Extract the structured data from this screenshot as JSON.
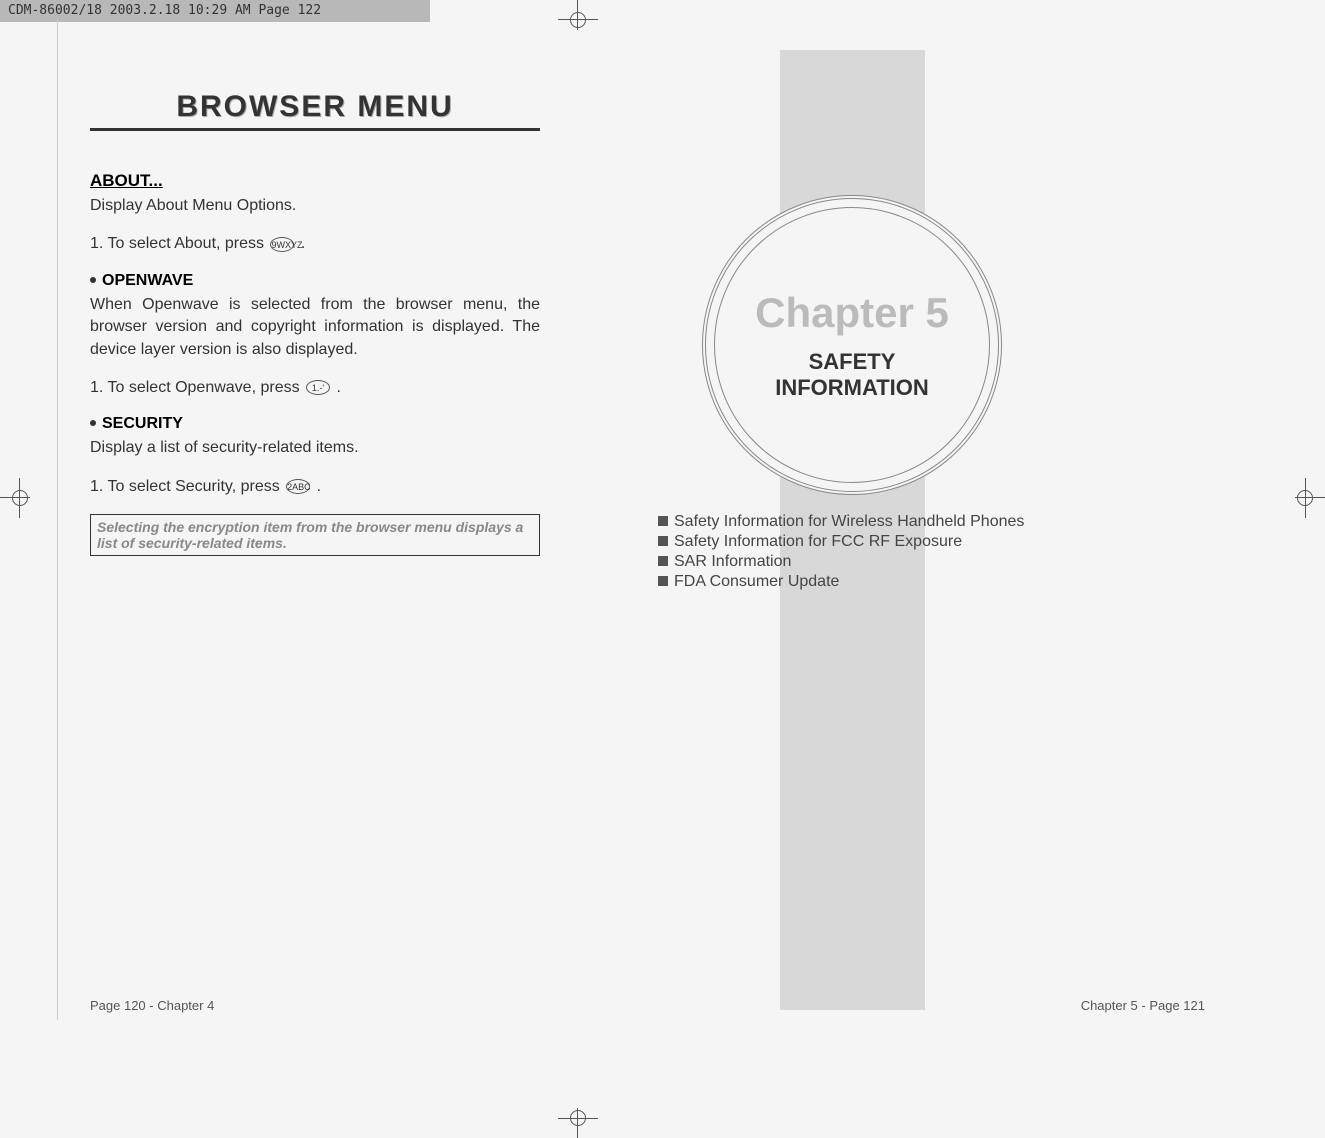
{
  "header_strip": "CDM-86002/18  2003.2.18  10:29 AM  Page 122",
  "left_page": {
    "title": "BROWSER MENU",
    "about_heading": "ABOUT...",
    "about_desc": "Display About Menu Options.",
    "about_step": "1. To select About, press ",
    "about_key": "9WXYZ",
    "openwave_heading": "OPENWAVE",
    "openwave_desc": "When Openwave is selected from the browser menu, the browser version and copyright information is displayed. The device layer version is also displayed.",
    "openwave_step": "1. To select Openwave, press ",
    "openwave_key": "1.-'",
    "security_heading": "SECURITY",
    "security_desc": "Display a list of security-related items.",
    "security_step": "1. To select Security, press ",
    "security_key": "2ABC",
    "callout": "Selecting the encryption item from the browser menu displays a list of security-related items.",
    "footer": "Page 120 - Chapter 4"
  },
  "right_page": {
    "chapter_title": "Chapter 5",
    "chapter_sub1": "SAFETY",
    "chapter_sub2": "INFORMATION",
    "toc_items": [
      "Safety Information for Wireless Handheld Phones",
      "Safety Information for FCC RF Exposure",
      "SAR Information",
      "FDA Consumer Update"
    ],
    "footer": "Chapter 5 - Page 121"
  }
}
